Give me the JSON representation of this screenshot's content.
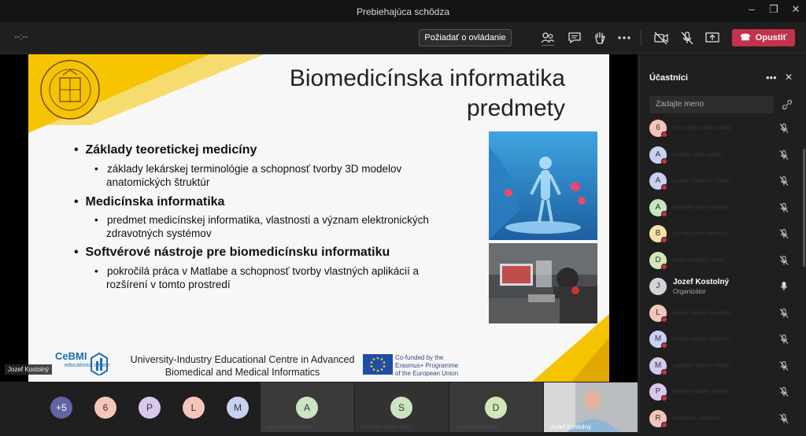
{
  "window": {
    "title": "Prebiehajúca schôdza"
  },
  "toolbar": {
    "timer": "--:--",
    "request_control": "Požiadať o ovládanie",
    "leave": "Opustiť"
  },
  "slide": {
    "title_line1": "Biomedicínska informatika",
    "title_line2": "predmety",
    "bullets": [
      {
        "heading": "Základy teoretickej medicíny",
        "sub": [
          "základy lekárskej terminológie a schopnosť tvorby 3D modelov",
          "anatomických štruktúr"
        ]
      },
      {
        "heading": "Medicínska informatika",
        "sub": [
          "predmet medicínskej informatika, vlastnosti a význam elektronických",
          "zdravotných systémov"
        ]
      },
      {
        "heading": "Softvérové nástroje pre biomedicínsku informatiku",
        "sub": [
          "pokročilá práca v Matlabe a schopnosť tvorby vlastných aplikácií a",
          "rozšírení v tomto prostredí"
        ]
      }
    ],
    "footer_line1": "University-Industry Educational Centre in Advanced",
    "footer_line2": "Biomedical and Medical Informatics",
    "cebmi_logo": "CeBMI",
    "cebmi_sub": "educational centre",
    "eu_line1": "Co-funded by the",
    "eu_line2": "Erasmus+ Programme",
    "eu_line3": "of the European Union",
    "seal_text": "ŽILINSKÁ UNIVERZITA · UNIVERSITAS SOLNENSIS",
    "presenter_tag": "Jozef Kostolný"
  },
  "bottom": {
    "overflow": "+5",
    "avatars": [
      "6",
      "P",
      "L",
      "M"
    ],
    "tiles": [
      {
        "initial": "A",
        "name": "··· ··· ······ ·······"
      },
      {
        "initial": "S",
        "name": "··· ······ ······· ·····"
      },
      {
        "initial": "D",
        "name": "··· ········ ········"
      }
    ],
    "video_name": "Jozef Kostolný"
  },
  "panel": {
    "title": "Účastníci",
    "search_placeholder": "Zadajte meno",
    "participants": [
      {
        "initial": "6",
        "name": "··· ····· ······ ······",
        "color": "#f4c5b8"
      },
      {
        "initial": "A",
        "name": "······· ···· ······",
        "color": "#c7d2f0"
      },
      {
        "initial": "A",
        "name": "······ ········ ······",
        "color": "#c7d2f0"
      },
      {
        "initial": "A",
        "name": "········ ····· ······",
        "color": "#c9e6c1"
      },
      {
        "initial": "B",
        "name": "··· ········ ········",
        "color": "#f7e2a5"
      },
      {
        "initial": "D",
        "name": "····· ········ ·····",
        "color": "#d2e6b8"
      },
      {
        "initial": "J",
        "name": "Jozef Kostolný",
        "role": "Organizátor",
        "color": "#cfd4da"
      },
      {
        "initial": "L",
        "name": "······ ······ ··· ·····",
        "color": "#f4c5b8"
      },
      {
        "initial": "M",
        "name": "······ ······ ········",
        "color": "#c7d2f0"
      },
      {
        "initial": "M",
        "name": "········ ······ ······",
        "color": "#d8c8ee"
      },
      {
        "initial": "P",
        "name": "······· ······ ······",
        "color": "#d8c8ee"
      },
      {
        "initial": "R",
        "name": "········· ········",
        "color": "#f4c5b8"
      }
    ]
  }
}
